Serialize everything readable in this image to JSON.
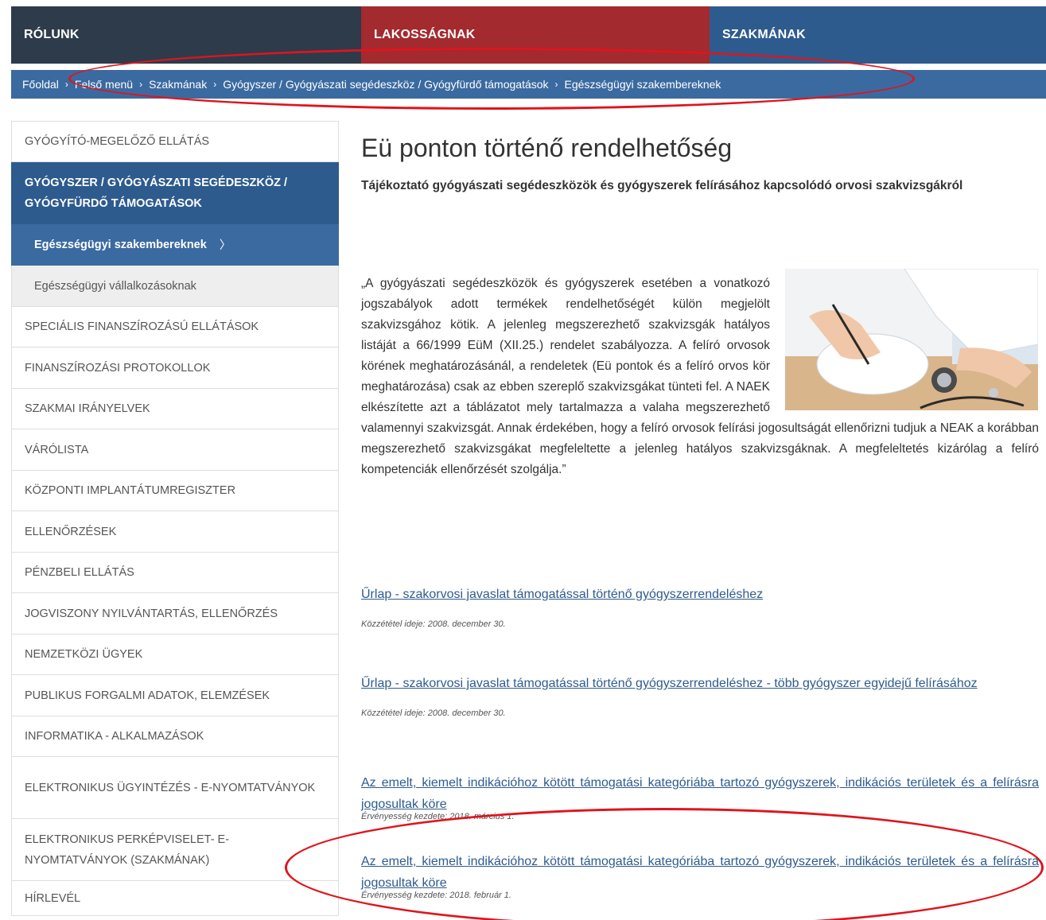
{
  "topnav": {
    "tabs": [
      {
        "label": "RÓLUNK"
      },
      {
        "label": "LAKOSSÁGNAK"
      },
      {
        "label": "SZAKMÁNAK"
      }
    ]
  },
  "breadcrumb": {
    "items": [
      "Főoldal",
      "Felső menü",
      "Szakmának",
      "Gyógyszer / Gyógyászati segédeszköz / Gyógyfürdő támogatások",
      "Egészségügyi szakembereknek"
    ],
    "separator": "›"
  },
  "sidebar": {
    "items": [
      {
        "label": "GYÓGYÍTÓ-MEGELŐZŐ ELLÁTÁS"
      },
      {
        "label": "GYÓGYSZER / GYÓGYÁSZATI SEGÉDESZKÖZ / GYÓGYFÜRDŐ TÁMOGATÁSOK"
      },
      {
        "label": "Egészségügyi szakembereknek"
      },
      {
        "label": "Egészségügyi vállalkozásoknak"
      },
      {
        "label": "SPECIÁLIS FINANSZÍROZÁSÚ ELLÁTÁSOK"
      },
      {
        "label": "FINANSZÍROZÁSI PROTOKOLLOK"
      },
      {
        "label": "SZAKMAI IRÁNYELVEK"
      },
      {
        "label": "VÁRÓLISTA"
      },
      {
        "label": "KÖZPONTI IMPLANTÁTUMREGISZTER"
      },
      {
        "label": "ELLENŐRZÉSEK"
      },
      {
        "label": "PÉNZBELI ELLÁTÁS"
      },
      {
        "label": "JOGVISZONY NYILVÁNTARTÁS, ELLENŐRZÉS"
      },
      {
        "label": "NEMZETKÖZI ÜGYEK"
      },
      {
        "label": "PUBLIKUS FORGALMI ADATOK, ELEMZÉSEK"
      },
      {
        "label": "INFORMATIKA - ALKALMAZÁSOK"
      },
      {
        "label": "ELEKTRONIKUS ÜGYINTÉZÉS - E-NYOMTATVÁNYOK"
      },
      {
        "label": "ELEKTRONIKUS PERKÉPVISELET- E-NYOMTATVÁNYOK (SZAKMÁNAK)"
      },
      {
        "label": "HÍRLEVÉL"
      }
    ],
    "active_chevron": "〉"
  },
  "main": {
    "title": "Eü ponton történő rendelhetőség",
    "lead": "Tájékoztató gyógyászati segédeszközök és gyógyszerek felírásához kapcsolódó orvosi szakvizsgákról",
    "quote": "„A gyógyászati segédeszközök és gyógyszerek esetében a vonatkozó jogszabályok adott termékek rendelhetőségét külön megjelölt szakvizsgához kötik. A jelenleg megszerezhető szakvizsgák hatályos listáját a 66/1999 EüM (XII.25.) rendelet szabályozza. A felíró orvosok körének meghatározásánál, a rendeletek (Eü pontok és a felíró orvos kör meghatározása) csak az ebben szereplő szakvizsgákat tünteti fel. A NAEK elkészítette azt a táblázatot mely tartalmazza a valaha megszerezhető valamennyi szakvizsgát. Annak érdekében, hogy a felíró orvosok felírási jogosultságát ellenőrizni tudjuk a NEAK a korábban megszerezhető szakvizsgákat megfeleltette a jelenleg hatályos szakvizsgáknak. A megfeleltetés kizárólag a felíró kompetenciák ellenőrzését szolgálja.”",
    "documents": [
      {
        "link": "Űrlap - szakorvosi javaslat támogatással történő gyógyszerrendeléshez",
        "meta": "Közzététel ideje: 2008. december 30."
      },
      {
        "link": "Űrlap - szakorvosi javaslat támogatással történő gyógyszerrendeléshez - több gyógyszer egyidejű felírásához",
        "meta": "Közzététel ideje: 2008. december 30."
      },
      {
        "link": "Az emelt, kiemelt indikációhoz kötött támogatási kategóriába tartozó gyógyszerek, indikációs területek és a felírásra jogosultak köre",
        "meta": "Érvényesség kezdete: 2018. március 1."
      },
      {
        "link": "Az emelt, kiemelt indikációhoz kötött támogatási kategóriába tartozó gyógyszerek, indikációs területek és a felírásra jogosultak köre",
        "meta": "Érvényesség kezdete: 2018. február 1."
      }
    ]
  },
  "colors": {
    "nav_dark": "#2d3b4b",
    "nav_red": "#a32a2e",
    "nav_blue": "#2e5b8e",
    "breadcrumb_blue": "#3b6aa0",
    "link": "#2e5b8e",
    "annotation_red": "#e0141c"
  },
  "icons": {
    "photo": "doctor-writing-prescription-photo"
  }
}
